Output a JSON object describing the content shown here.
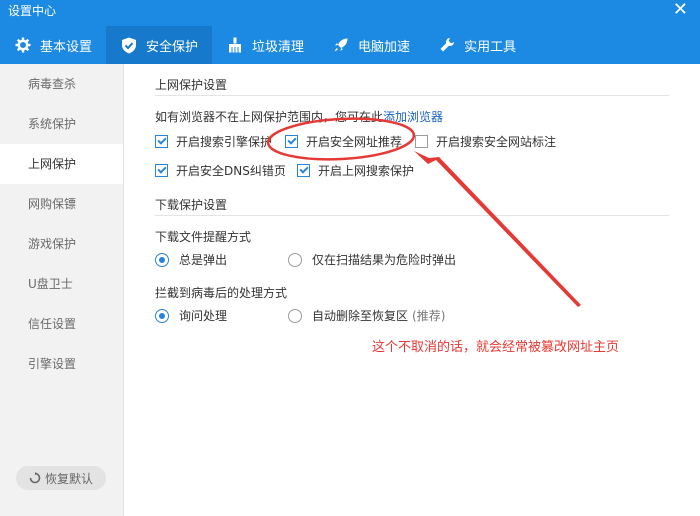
{
  "window": {
    "title": "设置中心",
    "close_glyph": "✕"
  },
  "tabs": [
    {
      "label": "基本设置",
      "icon": "gear-icon"
    },
    {
      "label": "安全保护",
      "icon": "shield-icon"
    },
    {
      "label": "垃圾清理",
      "icon": "broom-icon"
    },
    {
      "label": "电脑加速",
      "icon": "rocket-icon"
    },
    {
      "label": "实用工具",
      "icon": "wrench-icon"
    }
  ],
  "sidebar": {
    "items": [
      {
        "label": "病毒查杀"
      },
      {
        "label": "系统保护"
      },
      {
        "label": "上网保护"
      },
      {
        "label": "网购保镖"
      },
      {
        "label": "游戏保护"
      },
      {
        "label": "U盘卫士"
      },
      {
        "label": "信任设置"
      },
      {
        "label": "引擎设置"
      }
    ],
    "restore_label": "恢复默认"
  },
  "web_protection": {
    "title": "上网保护设置",
    "hint": "如有浏览器不在上网保护范围内，您可在此",
    "add_browser_link": "添加浏览器",
    "options": [
      {
        "label": "开启搜索引擎保护",
        "checked": true
      },
      {
        "label": "开启安全网址推荐",
        "checked": true
      },
      {
        "label": "开启搜索安全网站标注",
        "checked": false
      },
      {
        "label": "开启安全DNS纠错页",
        "checked": true
      },
      {
        "label": "开启上网搜索保护",
        "checked": true
      }
    ]
  },
  "download_protection": {
    "title": "下载保护设置",
    "reminder_title": "下载文件提醒方式",
    "reminder_options": [
      {
        "label": "总是弹出",
        "checked": true
      },
      {
        "label": "仅在扫描结果为危险时弹出",
        "checked": false
      }
    ],
    "handling_title": "拦截到病毒后的处理方式",
    "handling_options": [
      {
        "label": "询问处理",
        "checked": true
      },
      {
        "label": "自动删除至恢复区",
        "suffix": "(推荐)",
        "checked": false
      }
    ]
  },
  "annotation": {
    "text": "这个不取消的话，就会经常被篡改网址主页",
    "color": "#e53935"
  },
  "colors": {
    "accent": "#1c8ae3",
    "active_tab": "#1679cc",
    "link": "#1a60c6"
  }
}
